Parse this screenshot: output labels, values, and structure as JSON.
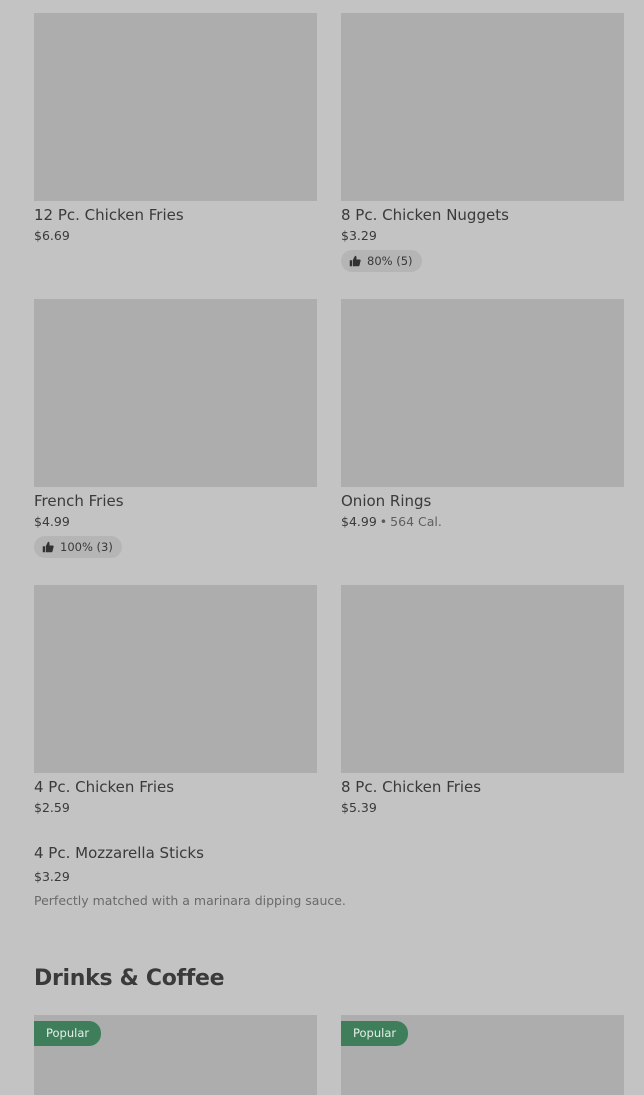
{
  "items": [
    {
      "name": "12 Pc. Chicken Fries",
      "price": "$6.69"
    },
    {
      "name": "8 Pc. Chicken Nuggets",
      "price": "$3.29",
      "rating": "80% (5)"
    },
    {
      "name": "French Fries",
      "price": "$4.99",
      "rating": "100% (3)"
    },
    {
      "name": "Onion Rings",
      "price": "$4.99",
      "calories": "564 Cal."
    },
    {
      "name": "4 Pc. Chicken Fries",
      "price": "$2.59"
    },
    {
      "name": "8 Pc. Chicken Fries",
      "price": "$5.39"
    }
  ],
  "wide_item": {
    "name": "4 Pc. Mozzarella Sticks",
    "price": "$3.29",
    "description": "Perfectly matched with a marinara dipping sauce."
  },
  "section": {
    "title": "Drinks & Coffee"
  },
  "drinks": [
    {
      "badge": "Popular"
    },
    {
      "badge": "Popular"
    }
  ],
  "separator": "•",
  "colors": {
    "badge": "#3f7e5b",
    "placeholder": "#adadad",
    "background": "#c3c3c3"
  },
  "icons": {
    "rating": "thumbs-up-icon"
  }
}
